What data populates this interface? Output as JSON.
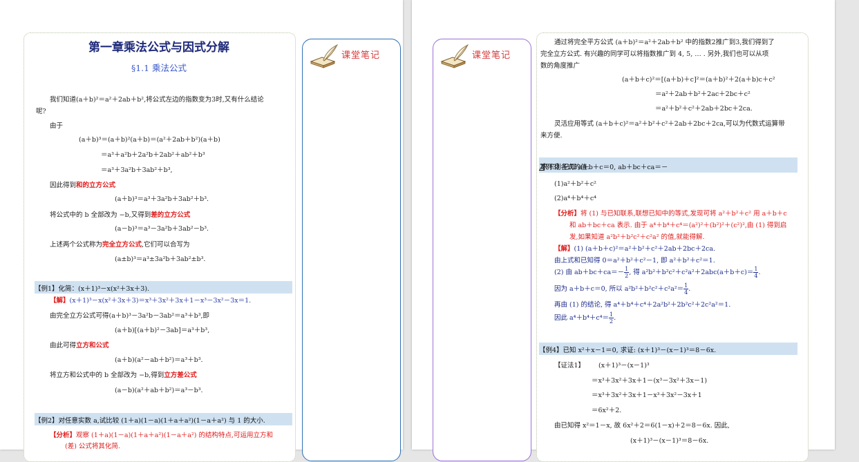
{
  "left_page": {
    "chapter_title": "第一章乘法公式与因式分解",
    "section_title": "§1.1 乘法公式",
    "intro": "我们知道(a＋b)²＝a²＋2ab＋b²,将公式左边的指数变为3时,又有什么结论",
    "intro2": "呢?",
    "you_yu": "由于",
    "eq1": "(a＋b)³＝(a＋b)²(a＋b)＝(a²＋2ab＋b²)(a＋b)",
    "eq2": "＝a³＋a²b＋2a²b＋2ab²＋ab²＋b³",
    "eq3": "＝a³＋3a²b＋3ab²＋b³,",
    "derive_sum_pre": "因此得到",
    "derive_sum_term": "和的立方公式",
    "sum_cube": "(a＋b)³＝a³＋3a²b＋3ab²＋b³.",
    "derive_diff_pre": "将公式中的 b 全部改为 −b,又得到",
    "derive_diff_term": "差的立方公式",
    "diff_cube": "(a－b)³＝a³－3a²b＋3ab²－b³.",
    "combined_pre": "上述两个公式称为",
    "combined_term": "完全立方公式",
    "combined_post": ",它们可以合写为",
    "combined": "(a±b)³＝a³±3a²b＋3ab²±b³.",
    "ex1_title": "【例1】化简：(x＋1)³－x(x²＋3x＋3).",
    "ex1_sol_tag": "【解】",
    "ex1_sol": "(x＋1)³－x(x²＋3x＋3)＝x³＋3x²＋3x＋1－x³－3x²－3x＝1.",
    "ex1_l2": "由完全立方公式可得(a＋b)³－3a²b－3ab²＝a³＋b³,即",
    "ex1_l3": "(a＋b)[(a＋b)²－3ab]＝a³＋b³,",
    "ex1_l4_pre": "由此可得",
    "ex1_l4_term": "立方和公式",
    "ex1_l5": "(a＋b)(a²－ab＋b²)＝a³＋b³.",
    "ex1_l6_pre": "将立方和公式中的 b 全部改为 −b,得到",
    "ex1_l6_term": "立方差公式",
    "ex1_l7": "(a－b)(a²＋ab＋b²)＝a³－b³.",
    "ex2_title": "【例2】对任意实数 a,试比较 (1＋a)(1－a)(1＋a＋a²)(1－a＋a²) 与 1 的大小.",
    "ex2_ana_tag": "【分析】",
    "ex2_ana1": "观察 (1＋a)(1－a)(1＋a＋a²)(1－a＋a²) 的结构特点,可运用立方和",
    "ex2_ana2": "(差) 公式将其化简."
  },
  "note_left": {
    "title": "课堂笔记"
  },
  "note_right": {
    "title": "课堂笔记"
  },
  "right_page": {
    "p1": "通过将完全平方公式 (a＋b)²＝a²＋2ab＋b² 中的指数2推广到3,我们得到了",
    "p2": "完全立方公式. 有兴趣的同学可以将指数推广到 4, 5, … . 另外,我们也可以从项",
    "p3": "数的角度推广",
    "r_eq1": "(a＋b＋c)²＝[(a＋b)＋c]²＝(a＋b)²＋2(a＋b)c＋c²",
    "r_eq2": "＝a²＋2ab＋b²＋2ac＋2bc＋c²",
    "r_eq3": "＝a²＋b²＋c²＋2ab＋2bc＋2ca.",
    "p4": "灵活应用等式 (a＋b＋c)²＝a²＋b²＋c²＋2ab＋2bc＋2ca,可以为代数式运算带",
    "p5": "来方便.",
    "ex3_title_a": "【例3】已知 a＋b＋c＝0, ab＋bc＋ca＝－",
    "ex3_frac_n": "1",
    "ex3_frac_d": "2",
    "ex3_title_b": ",求下列各式的值:",
    "ex3_q1": "(1)a²＋b²＋c²",
    "ex3_q2": "(2)a⁴＋b⁴＋c⁴",
    "ex3_ana_tag": "【分析】",
    "ex3_ana1": "将 (1) 与已知联系,联想已知中的等式,发现可将 a²＋b²＋c² 用 a＋b＋c",
    "ex3_ana2": "和 ab＋bc＋ca 表示. 由于 a⁴＋b⁴＋c⁴＝(a²)²＋(b²)²＋(c²)²,由 (1) 得到启",
    "ex3_ana3": "发,如果知道 a²b²＋b²c²＋c²a² 的值,就能得解.",
    "ex3_sol_tag": "【解】",
    "ex3_sol1": "(1) (a＋b＋c)²＝a²＋b²＋c²＋2ab＋2bc＋2ca.",
    "ex3_sol2": "由上式和已知得 0＝a²＋b²＋c²－1, 即 a²＋b²＋c²＝1.",
    "ex3_sol3a": "(2) 由 ab＋bc＋ca＝－",
    "ex3_sol3b": ", 得 a²b²＋b²c²＋c²a²＋2abc(a＋b＋c)＝",
    "ex3_sol3c": ".",
    "ex3_sol4a": "因为 a＋b＋c＝0, 所以 a²b²＋b²c²＋c²a²＝",
    "ex3_sol4b": ".",
    "ex3_sol5": "再由 (1) 的结论, 得 a⁴＋b⁴＋c⁴＋2a²b²＋2b²c²＋2c²a²＝1.",
    "ex3_sol6a": "因此 a⁴＋b⁴＋c⁴＝",
    "ex3_sol6b": ".",
    "frac_half_n": "1",
    "frac_half_d": "2",
    "frac_quarter_n": "1",
    "frac_quarter_d": "4",
    "ex4_title": "【例4】已知 x²＋x－1＝0, 求证: (x＋1)³－(x－1)³＝8－6x.",
    "ex4_tag": "【证法1】",
    "ex4_l1": "(x＋1)³－(x－1)³",
    "ex4_l2": "＝x³＋3x²＋3x＋1－(x³－3x²＋3x－1)",
    "ex4_l3": "＝x³＋3x²＋3x＋1－x³＋3x²－3x＋1",
    "ex4_l4": "＝6x²＋2.",
    "ex4_l5": "由已知得 x²＝1－x, 故 6x²＋2＝6(1－x)＋2＝8－6x. 因此,",
    "ex4_l6": "(x＋1)³－(x－1)³＝8－6x."
  }
}
